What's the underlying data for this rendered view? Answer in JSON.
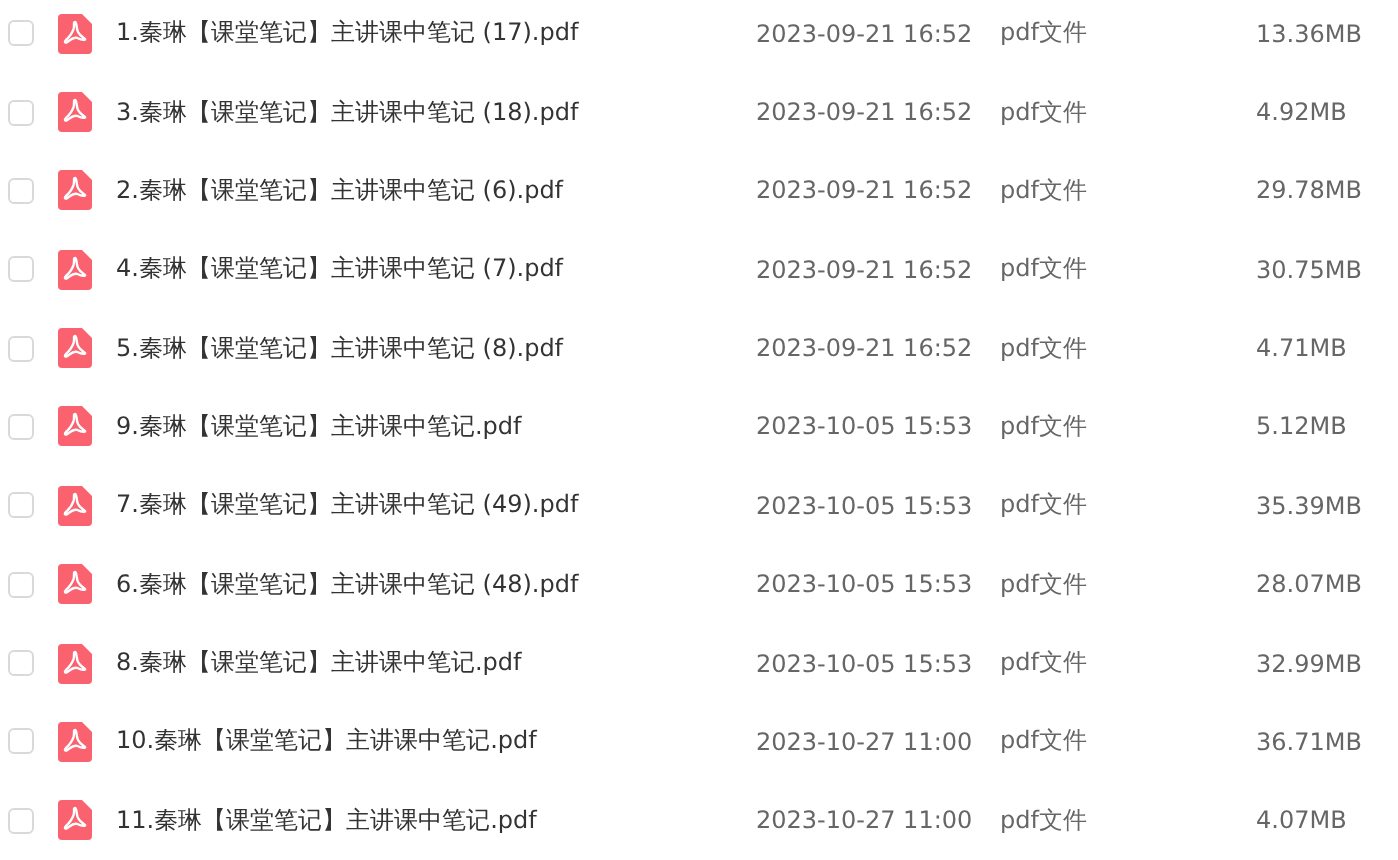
{
  "files": [
    {
      "name": "1.秦琳【课堂笔记】主讲课中笔记 (17).pdf",
      "date": "2023-09-21 16:52",
      "type": "pdf文件",
      "size": "13.36MB",
      "checked": false
    },
    {
      "name": "3.秦琳【课堂笔记】主讲课中笔记 (18).pdf",
      "date": "2023-09-21 16:52",
      "type": "pdf文件",
      "size": "4.92MB",
      "checked": false
    },
    {
      "name": "2.秦琳【课堂笔记】主讲课中笔记 (6).pdf",
      "date": "2023-09-21 16:52",
      "type": "pdf文件",
      "size": "29.78MB",
      "checked": false
    },
    {
      "name": "4.秦琳【课堂笔记】主讲课中笔记 (7).pdf",
      "date": "2023-09-21 16:52",
      "type": "pdf文件",
      "size": "30.75MB",
      "checked": false
    },
    {
      "name": "5.秦琳【课堂笔记】主讲课中笔记 (8).pdf",
      "date": "2023-09-21 16:52",
      "type": "pdf文件",
      "size": "4.71MB",
      "checked": false
    },
    {
      "name": "9.秦琳【课堂笔记】主讲课中笔记.pdf",
      "date": "2023-10-05 15:53",
      "type": "pdf文件",
      "size": "5.12MB",
      "checked": false
    },
    {
      "name": "7.秦琳【课堂笔记】主讲课中笔记 (49).pdf",
      "date": "2023-10-05 15:53",
      "type": "pdf文件",
      "size": "35.39MB",
      "checked": false
    },
    {
      "name": "6.秦琳【课堂笔记】主讲课中笔记 (48).pdf",
      "date": "2023-10-05 15:53",
      "type": "pdf文件",
      "size": "28.07MB",
      "checked": false
    },
    {
      "name": "8.秦琳【课堂笔记】主讲课中笔记.pdf",
      "date": "2023-10-05 15:53",
      "type": "pdf文件",
      "size": "32.99MB",
      "checked": false
    },
    {
      "name": "10.秦琳【课堂笔记】主讲课中笔记.pdf",
      "date": "2023-10-27 11:00",
      "type": "pdf文件",
      "size": "36.71MB",
      "checked": false
    },
    {
      "name": "11.秦琳【课堂笔记】主讲课中笔记.pdf",
      "date": "2023-10-27 11:00",
      "type": "pdf文件",
      "size": "4.07MB",
      "checked": false
    }
  ]
}
